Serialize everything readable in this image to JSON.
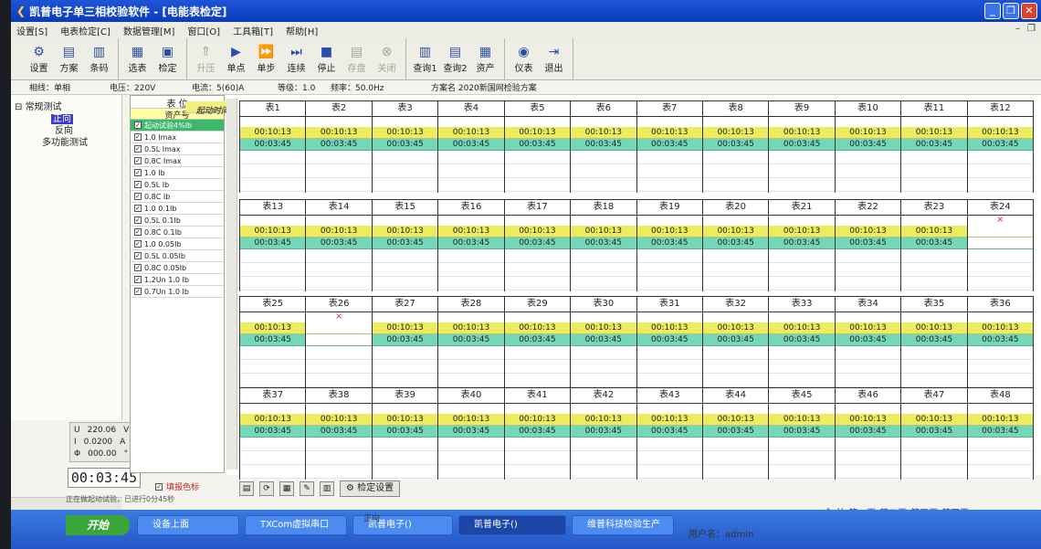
{
  "window": {
    "title": "凯普电子单三相校验软件 - [电能表检定]"
  },
  "menu": [
    "设置[S]",
    "电表检定[C]",
    "数据管理[M]",
    "窗口[O]",
    "工具箱[T]",
    "帮助[H]"
  ],
  "toolbar": {
    "groups": [
      [
        {
          "label": "设置",
          "icon": "⚙"
        },
        {
          "label": "方案",
          "icon": "▤"
        },
        {
          "label": "条码",
          "icon": "▥"
        }
      ],
      [
        {
          "label": "选表",
          "icon": "▦"
        },
        {
          "label": "检定",
          "icon": "▣"
        }
      ],
      [
        {
          "label": "升压",
          "icon": "⇑",
          "disabled": true
        },
        {
          "label": "单点",
          "icon": "▶"
        },
        {
          "label": "单步",
          "icon": "⏩"
        },
        {
          "label": "连续",
          "icon": "⏭"
        },
        {
          "label": "停止",
          "icon": "■"
        },
        {
          "label": "存盘",
          "icon": "▤",
          "disabled": true
        },
        {
          "label": "关闭",
          "icon": "⊗",
          "disabled": true
        }
      ],
      [
        {
          "label": "查询1",
          "icon": "▥"
        },
        {
          "label": "查询2",
          "icon": "▤"
        },
        {
          "label": "资产",
          "icon": "▦"
        }
      ],
      [
        {
          "label": "仪表",
          "icon": "◉"
        },
        {
          "label": "退出",
          "icon": "⇥"
        }
      ]
    ]
  },
  "status": {
    "phase": "相线：单相",
    "voltage": "电压：220V",
    "current": "电流：5(60)A",
    "grade": "等级：1.0",
    "freq": "频率：50.0Hz",
    "scheme": "方案名 2020新国网检验方案"
  },
  "tree": {
    "root": "常规测试",
    "items": [
      "正向",
      "反向"
    ],
    "other": "多功能测试"
  },
  "config": {
    "header": "表  位",
    "asset": "资产号",
    "start": "起动时间...",
    "points": [
      "起动试验4%Ib",
      "1.0 Imax",
      "0.5L Imax",
      "0.8C Imax",
      "1.0 Ib",
      "0.5L Ib",
      "0.8C Ib",
      "1.0 0.1Ib",
      "0.5L 0.1Ib",
      "0.8C 0.1Ib",
      "1.0 0.05Ib",
      "0.5L 0.05Ib",
      "0.8C 0.05Ib",
      "1.2Un 1.0 Ib",
      "0.7Un 1.0 Ib"
    ]
  },
  "meters": {
    "time1": "00:10:13",
    "time2": "00:03:45",
    "rows": [
      {
        "labels": [
          "表1",
          "表2",
          "表3",
          "表4",
          "表5",
          "表6",
          "表7",
          "表8",
          "表9",
          "表10",
          "表11",
          "表12"
        ],
        "x": [],
        "blank": []
      },
      {
        "labels": [
          "表13",
          "表14",
          "表15",
          "表16",
          "表17",
          "表18",
          "表19",
          "表20",
          "表21",
          "表22",
          "表23",
          "表24"
        ],
        "x": [
          11
        ],
        "blank": [
          11
        ]
      },
      {
        "labels": [
          "表25",
          "表26",
          "表27",
          "表28",
          "表29",
          "表30",
          "表31",
          "表32",
          "表33",
          "表34",
          "表35",
          "表36"
        ],
        "x": [
          1
        ],
        "blank": [
          1
        ]
      },
      {
        "labels": [
          "表37",
          "表38",
          "表39",
          "表40",
          "表41",
          "表42",
          "表43",
          "表44",
          "表45",
          "表46",
          "表47",
          "表48"
        ],
        "x": [],
        "blank": []
      }
    ]
  },
  "readings": {
    "u_label": "U",
    "u_value": "220.06",
    "u_unit": "V",
    "i_label": "I",
    "i_value": "0.0200",
    "i_unit": "A",
    "p_label": "Φ",
    "p_value": "000.00",
    "p_unit": "°"
  },
  "timer": "00:03:45",
  "show_color": "填报色标",
  "info": "正在做起动试验，已进行0分45秒",
  "check_settings": "检定设置",
  "direction": "正向",
  "pager": [
    "全 并",
    "第一页",
    "第二页",
    "第三页",
    "第四页"
  ],
  "taskbar": {
    "start": "开始",
    "tasks": [
      "设备上面",
      "TXCom虚拟串口",
      "凯普电子()",
      "凯普电子()",
      "维普科技检验生产"
    ],
    "user": "用户名：admin"
  }
}
